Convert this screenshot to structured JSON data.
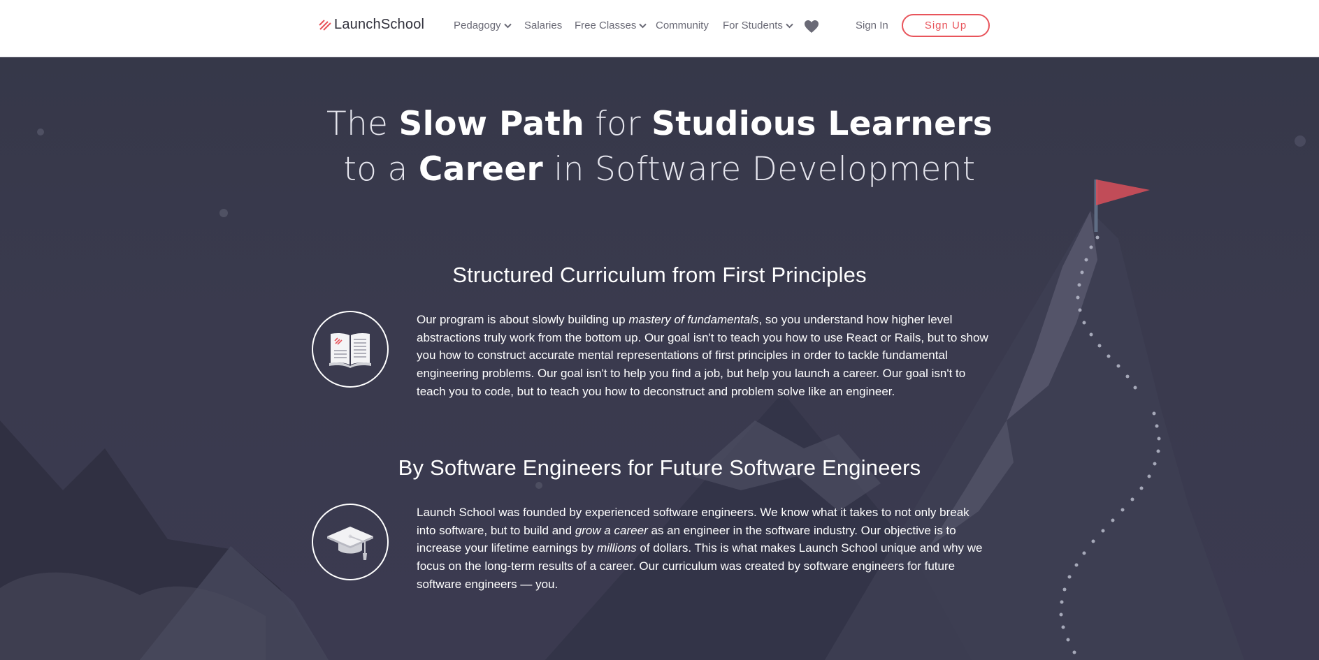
{
  "brand": {
    "name": "LaunchSchool",
    "accent": "#e8545b"
  },
  "nav": {
    "items": [
      {
        "label": "Pedagogy",
        "dropdown": true
      },
      {
        "label": "Salaries",
        "dropdown": false
      },
      {
        "label": "Free Classes",
        "dropdown": true
      },
      {
        "label": "Community",
        "dropdown": false
      },
      {
        "label": "For Students",
        "dropdown": true
      }
    ],
    "heart_icon": "heart-icon",
    "sign_in": "Sign In",
    "sign_up": "Sign Up"
  },
  "hero": {
    "line1": {
      "a": "The ",
      "b": "Slow Path",
      "c": " for ",
      "d": "Studious Learners"
    },
    "line2": {
      "a": "to a ",
      "b": "Career",
      "c": " in Software Development"
    }
  },
  "sections": [
    {
      "title": "Structured Curriculum from First Principles",
      "icon": "open-book-icon",
      "p_pre": "Our program is about slowly building up ",
      "p_em": "mastery of fundamentals",
      "p_post": ", so you understand how higher level abstractions truly work from the bottom up. Our goal isn't to teach you how to use React or Rails, but to show you how to construct accurate mental representations of first principles in order to tackle fundamental engineering problems. Our goal isn't to help you find a job, but help you launch a career. Our goal isn't to teach you to code, but to teach you how to deconstruct and problem solve like an engineer."
    },
    {
      "title": "By Software Engineers for Future Software Engineers",
      "icon": "graduation-cap-icon",
      "p_pre": "Launch School was founded by experienced software engineers. We know what it takes to not only break into software, but to build and ",
      "p_em1": "grow a career",
      "p_mid": " as an engineer in the software industry. Our objective is to increase your lifetime earnings by ",
      "p_em2": "millions",
      "p_post": " of dollars. This is what makes Launch School unique and why we focus on the long-term results of a career. Our curriculum was created by software engineers for future software engineers — you."
    }
  ]
}
